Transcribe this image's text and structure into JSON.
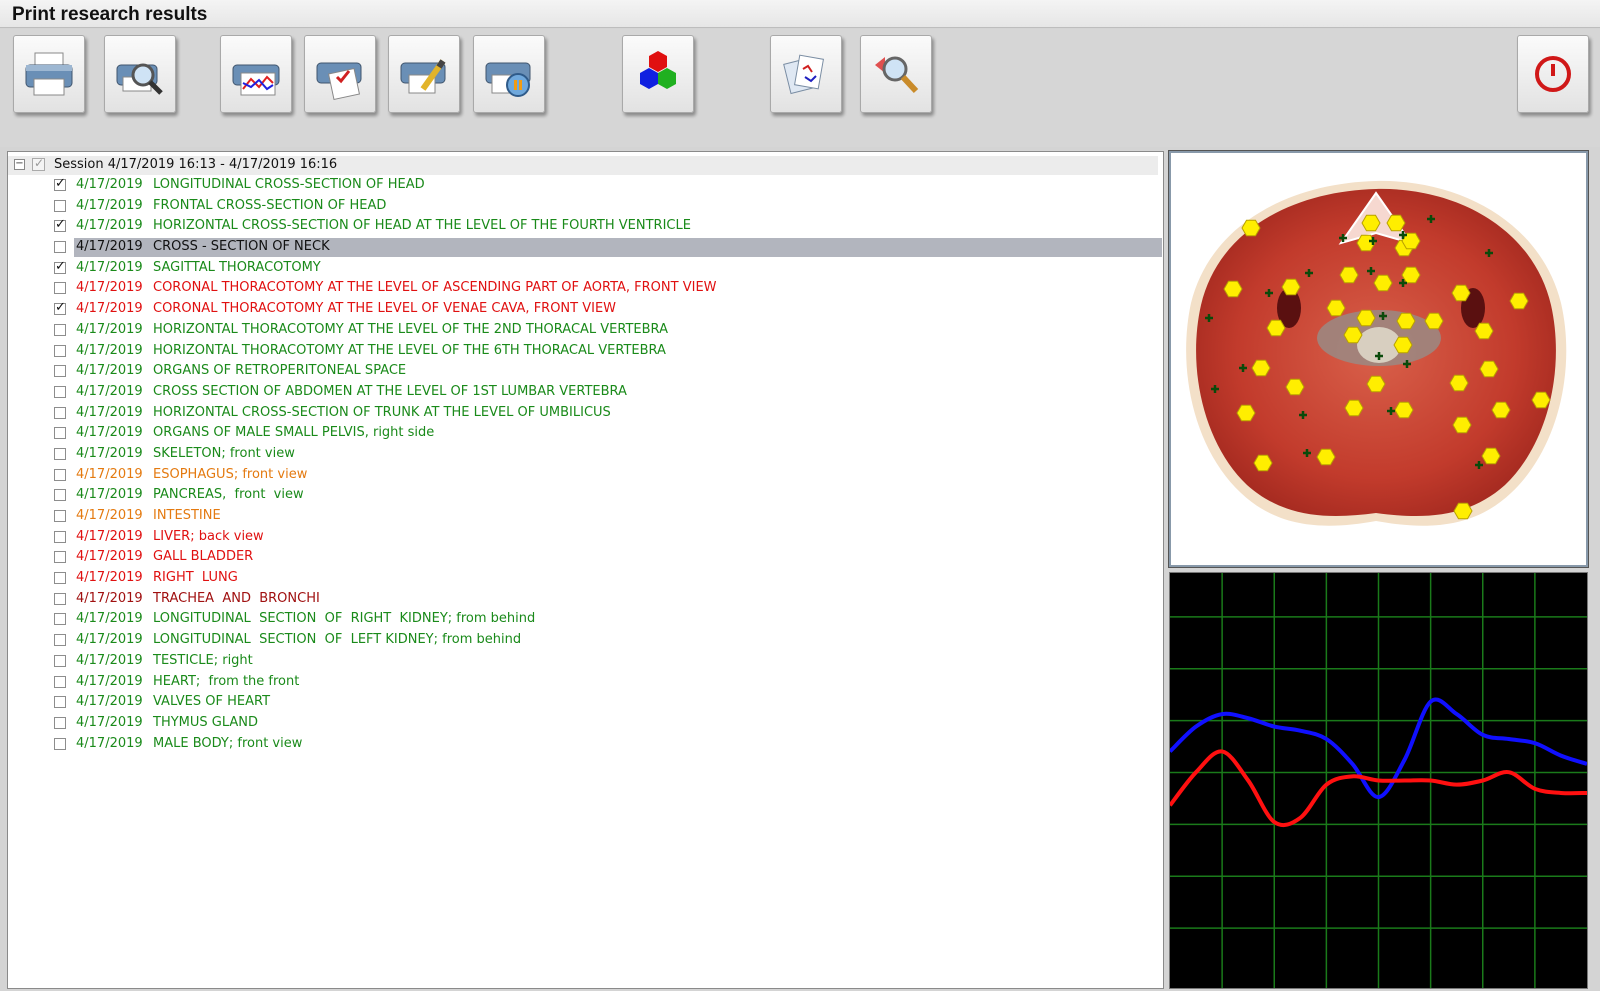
{
  "window": {
    "title": "Print research results"
  },
  "toolbar": {
    "buttons": [
      {
        "name": "print-button",
        "icon": "printer-icon"
      },
      {
        "name": "print-preview-button",
        "icon": "print-preview-icon"
      },
      {
        "name": "print-graph-button",
        "icon": "print-graph-icon"
      },
      {
        "name": "print-report-button",
        "icon": "print-report-icon"
      },
      {
        "name": "print-edit-button",
        "icon": "print-edit-icon"
      },
      {
        "name": "print-audio-button",
        "icon": "print-audio-icon"
      },
      {
        "name": "color-spectrum-button",
        "icon": "rgb-hexagons-icon"
      },
      {
        "name": "documents-button",
        "icon": "documents-icon"
      },
      {
        "name": "search-button",
        "icon": "magnifier-icon"
      },
      {
        "name": "exit-button",
        "icon": "power-icon"
      }
    ],
    "colors": {
      "red": "#e01010",
      "green": "#20b020",
      "blue": "#1020e0"
    }
  },
  "session": {
    "label": "Session 4/17/2019 16:13 - 4/17/2019 16:16",
    "checked": true
  },
  "items": [
    {
      "date": "4/17/2019",
      "name": "LONGITUDINAL CROSS-SECTION OF HEAD",
      "color": "green",
      "checked": true,
      "selected": false
    },
    {
      "date": "4/17/2019",
      "name": "FRONTAL CROSS-SECTION OF HEAD",
      "color": "green",
      "checked": false,
      "selected": false
    },
    {
      "date": "4/17/2019",
      "name": "HORIZONTAL CROSS-SECTION OF HEAD AT THE LEVEL OF THE FOURTH VENTRICLE",
      "color": "green",
      "checked": true,
      "selected": false
    },
    {
      "date": "4/17/2019",
      "name": "CROSS - SECTION OF NECK",
      "color": "black",
      "checked": false,
      "selected": true
    },
    {
      "date": "4/17/2019",
      "name": "SAGITTAL THORACOTOMY",
      "color": "green",
      "checked": true,
      "selected": false
    },
    {
      "date": "4/17/2019",
      "name": "CORONAL THORACOTOMY AT THE LEVEL OF ASCENDING PART OF AORTA, FRONT VIEW",
      "color": "red",
      "checked": false,
      "selected": false
    },
    {
      "date": "4/17/2019",
      "name": "CORONAL THORACOTOMY AT THE LEVEL OF VENAE CAVA, FRONT VIEW",
      "color": "red",
      "checked": true,
      "selected": false
    },
    {
      "date": "4/17/2019",
      "name": "HORIZONTAL THORACOTOMY AT THE LEVEL OF THE 2ND THORACAL VERTEBRA",
      "color": "green",
      "checked": false,
      "selected": false
    },
    {
      "date": "4/17/2019",
      "name": "HORIZONTAL THORACOTOMY AT THE LEVEL OF THE 6TH THORACAL VERTEBRA",
      "color": "green",
      "checked": false,
      "selected": false
    },
    {
      "date": "4/17/2019",
      "name": "ORGANS OF RETROPERITONEAL SPACE",
      "color": "green",
      "checked": false,
      "selected": false
    },
    {
      "date": "4/17/2019",
      "name": "CROSS SECTION OF ABDOMEN AT THE LEVEL OF 1ST LUMBAR VERTEBRA",
      "color": "green",
      "checked": false,
      "selected": false
    },
    {
      "date": "4/17/2019",
      "name": "HORIZONTAL CROSS-SECTION OF TRUNK AT THE LEVEL OF UMBILICUS",
      "color": "green",
      "checked": false,
      "selected": false
    },
    {
      "date": "4/17/2019",
      "name": "ORGANS OF MALE SMALL PELVIS, right side",
      "color": "green",
      "checked": false,
      "selected": false
    },
    {
      "date": "4/17/2019",
      "name": "SKELETON; front view",
      "color": "green",
      "checked": false,
      "selected": false
    },
    {
      "date": "4/17/2019",
      "name": "ESOPHAGUS; front view",
      "color": "orange",
      "checked": false,
      "selected": false
    },
    {
      "date": "4/17/2019",
      "name": "PANCREAS,  front  view",
      "color": "green",
      "checked": false,
      "selected": false
    },
    {
      "date": "4/17/2019",
      "name": "INTESTINE",
      "color": "orange",
      "checked": false,
      "selected": false
    },
    {
      "date": "4/17/2019",
      "name": "LIVER; back view",
      "color": "red",
      "checked": false,
      "selected": false
    },
    {
      "date": "4/17/2019",
      "name": "GALL BLADDER",
      "color": "red",
      "checked": false,
      "selected": false
    },
    {
      "date": "4/17/2019",
      "name": "RIGHT  LUNG",
      "color": "red",
      "checked": false,
      "selected": false
    },
    {
      "date": "4/17/2019",
      "name": "TRACHEA  AND  BRONCHI",
      "color": "darkred",
      "checked": false,
      "selected": false
    },
    {
      "date": "4/17/2019",
      "name": "LONGITUDINAL  SECTION  OF  RIGHT  KIDNEY; from behind",
      "color": "green",
      "checked": false,
      "selected": false
    },
    {
      "date": "4/17/2019",
      "name": "LONGITUDINAL  SECTION  OF  LEFT KIDNEY; from behind",
      "color": "green",
      "checked": false,
      "selected": false
    },
    {
      "date": "4/17/2019",
      "name": "TESTICLE; right",
      "color": "green",
      "checked": false,
      "selected": false
    },
    {
      "date": "4/17/2019",
      "name": "HEART;  from the front",
      "color": "green",
      "checked": false,
      "selected": false
    },
    {
      "date": "4/17/2019",
      "name": "VALVES OF HEART",
      "color": "green",
      "checked": false,
      "selected": false
    },
    {
      "date": "4/17/2019",
      "name": "THYMUS GLAND",
      "color": "green",
      "checked": false,
      "selected": false
    },
    {
      "date": "4/17/2019",
      "name": "MALE BODY; front view",
      "color": "green",
      "checked": false,
      "selected": false
    }
  ],
  "preview_image": {
    "subject": "neck-cross-section",
    "marker_color": "#ffee00",
    "tissue_color": "#c0392b"
  },
  "chart_data": {
    "type": "line",
    "grid": true,
    "background": "#000000",
    "grid_color": "#1a7a1a",
    "x": [
      0,
      1,
      2,
      3,
      4,
      5,
      6,
      7,
      8,
      9,
      10,
      11,
      12,
      13,
      14,
      15,
      16
    ],
    "ylim": [
      0,
      100
    ],
    "series": [
      {
        "color": "#1010ff",
        "values": [
          57,
          63,
          66,
          65,
          63,
          62,
          60,
          54,
          46,
          55,
          69,
          66,
          61,
          60,
          59,
          56,
          54
        ]
      },
      {
        "color": "#ff1010",
        "values": [
          44,
          52,
          57,
          50,
          40,
          41,
          49,
          51,
          50,
          50,
          50,
          49,
          50,
          52,
          48,
          47,
          47
        ]
      }
    ]
  }
}
